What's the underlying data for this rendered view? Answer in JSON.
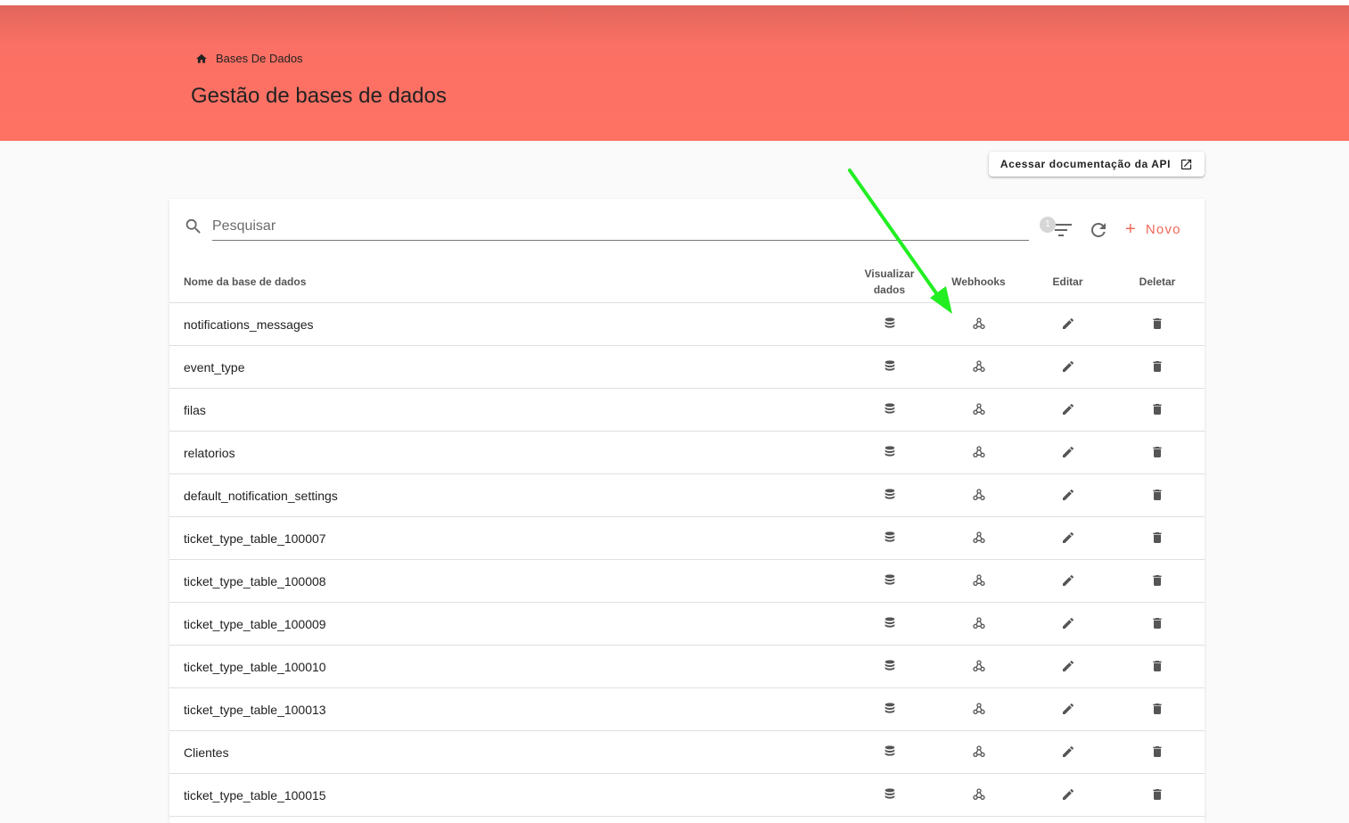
{
  "header": {
    "breadcrumb_icon": "home-icon",
    "breadcrumb_label": "Bases De Dados",
    "title": "Gestão de bases de dados",
    "background_color": "#fe7264"
  },
  "api_button": {
    "label": "Acessar documentação da API",
    "icon": "open-in-new-icon"
  },
  "toolbar": {
    "search_placeholder": "Pesquisar",
    "search_value": "",
    "filter_badge": "1",
    "new_label": "Novo",
    "accent_color": "#f2685a"
  },
  "table": {
    "columns": {
      "name": "Nome da base de dados",
      "view": "Visualizar dados",
      "webhooks": "Webhooks",
      "edit": "Editar",
      "delete": "Deletar"
    },
    "rows": [
      "notifications_messages",
      "event_type",
      "filas",
      "relatorios",
      "default_notification_settings",
      "ticket_type_table_100007",
      "ticket_type_table_100008",
      "ticket_type_table_100009",
      "ticket_type_table_100010",
      "ticket_type_table_100013",
      "Clientes",
      "ticket_type_table_100015"
    ],
    "row_icons": {
      "view": "database-icon",
      "webhooks": "webhook-icon",
      "edit": "pencil-icon",
      "delete": "trash-icon"
    }
  },
  "annotation": {
    "type": "arrow",
    "color": "#22ee22",
    "points_to": "webhooks-column"
  }
}
